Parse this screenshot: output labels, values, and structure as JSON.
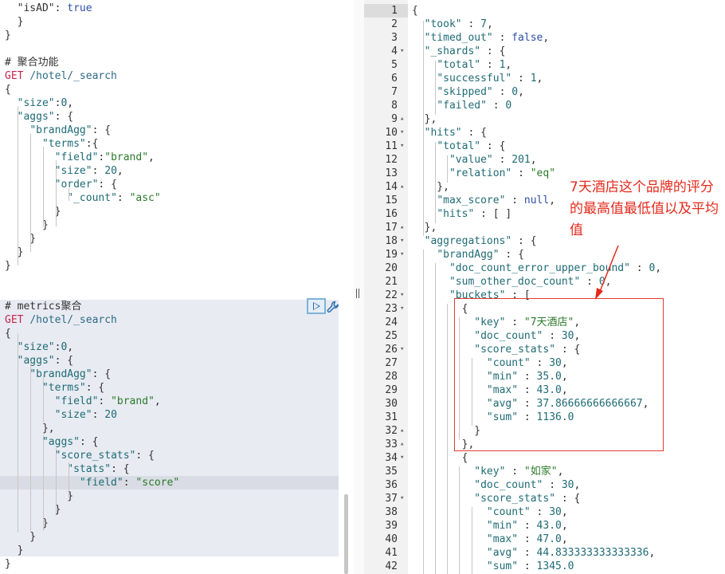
{
  "colors": {
    "accent": "#2b6cb0",
    "annotation": "#e32a1c",
    "request_bg": "#e8ebf2",
    "gutter": "#f2f2f2"
  },
  "icons": {
    "run": "play-icon",
    "settings": "wrench-icon",
    "splitter": "splitter-handle-icon"
  },
  "left_editor": {
    "lines": [
      [
        [
          "punc",
          "  \"isAD\": "
        ],
        [
          "bool",
          "true"
        ]
      ],
      [
        [
          "punc",
          "  }"
        ]
      ],
      [
        [
          "punc",
          "}"
        ]
      ],
      [],
      [
        [
          "comment",
          "# 聚合功能"
        ]
      ],
      [
        [
          "method",
          "GET"
        ],
        [
          "punc",
          " "
        ],
        [
          "url",
          "/hotel/_search"
        ]
      ],
      [
        [
          "punc",
          "{"
        ]
      ],
      [
        [
          "punc",
          "  "
        ],
        [
          "key",
          "\"size\""
        ],
        [
          "punc",
          ":"
        ],
        [
          "num",
          "0"
        ],
        [
          "punc",
          ","
        ]
      ],
      [
        [
          "punc",
          "  "
        ],
        [
          "key",
          "\"aggs\""
        ],
        [
          "punc",
          ": {"
        ]
      ],
      [
        [
          "punc",
          "    "
        ],
        [
          "key",
          "\"brandAgg\""
        ],
        [
          "punc",
          ": {"
        ]
      ],
      [
        [
          "punc",
          "      "
        ],
        [
          "key",
          "\"terms\""
        ],
        [
          "punc",
          ":{"
        ]
      ],
      [
        [
          "punc",
          "        "
        ],
        [
          "key",
          "\"field\""
        ],
        [
          "punc",
          ":"
        ],
        [
          "str",
          "\"brand\""
        ],
        [
          "punc",
          ","
        ]
      ],
      [
        [
          "punc",
          "        "
        ],
        [
          "key",
          "\"size\""
        ],
        [
          "punc",
          ": "
        ],
        [
          "num",
          "20"
        ],
        [
          "punc",
          ","
        ]
      ],
      [
        [
          "punc",
          "        "
        ],
        [
          "key",
          "\"order\""
        ],
        [
          "punc",
          ": {"
        ]
      ],
      [
        [
          "punc",
          "          "
        ],
        [
          "key",
          "\"_count\""
        ],
        [
          "punc",
          ": "
        ],
        [
          "str",
          "\"asc\""
        ]
      ],
      [
        [
          "punc",
          "        }"
        ]
      ],
      [
        [
          "punc",
          "      }"
        ]
      ],
      [
        [
          "punc",
          "    }"
        ]
      ],
      [
        [
          "punc",
          "  }"
        ]
      ],
      [
        [
          "punc",
          "}"
        ]
      ],
      [],
      [],
      [
        [
          "comment",
          "# metrics聚合"
        ]
      ],
      [
        [
          "method",
          "GET"
        ],
        [
          "punc",
          " "
        ],
        [
          "url",
          "/hotel/_search"
        ]
      ],
      [
        [
          "punc",
          "{"
        ]
      ],
      [
        [
          "punc",
          "  "
        ],
        [
          "key",
          "\"size\""
        ],
        [
          "punc",
          ":"
        ],
        [
          "num",
          "0"
        ],
        [
          "punc",
          ","
        ]
      ],
      [
        [
          "punc",
          "  "
        ],
        [
          "key",
          "\"aggs\""
        ],
        [
          "punc",
          ": {"
        ]
      ],
      [
        [
          "punc",
          "    "
        ],
        [
          "key",
          "\"brandAgg\""
        ],
        [
          "punc",
          ": {"
        ]
      ],
      [
        [
          "punc",
          "      "
        ],
        [
          "key",
          "\"terms\""
        ],
        [
          "punc",
          ": {"
        ]
      ],
      [
        [
          "punc",
          "        "
        ],
        [
          "key",
          "\"field\""
        ],
        [
          "punc",
          ": "
        ],
        [
          "str",
          "\"brand\""
        ],
        [
          "punc",
          ","
        ]
      ],
      [
        [
          "punc",
          "        "
        ],
        [
          "key",
          "\"size\""
        ],
        [
          "punc",
          ": "
        ],
        [
          "num",
          "20"
        ]
      ],
      [
        [
          "punc",
          "      },"
        ]
      ],
      [
        [
          "punc",
          "      "
        ],
        [
          "key",
          "\"aggs\""
        ],
        [
          "punc",
          ": {"
        ]
      ],
      [
        [
          "punc",
          "        "
        ],
        [
          "key",
          "\"score_stats\""
        ],
        [
          "punc",
          ": {"
        ]
      ],
      [
        [
          "punc",
          "          "
        ],
        [
          "key",
          "\"stats\""
        ],
        [
          "punc",
          ": {"
        ]
      ],
      [
        [
          "punc",
          "            "
        ],
        [
          "key",
          "\"field\""
        ],
        [
          "punc",
          ": "
        ],
        [
          "str",
          "\"score\""
        ]
      ],
      [
        [
          "punc",
          "          }"
        ]
      ],
      [
        [
          "punc",
          "        }"
        ]
      ],
      [
        [
          "punc",
          "      }"
        ]
      ],
      [
        [
          "punc",
          "    }"
        ]
      ],
      [
        [
          "punc",
          "  }"
        ]
      ],
      [
        [
          "punc",
          "}"
        ]
      ]
    ]
  },
  "right_editor": {
    "line_numbers": [
      "1",
      "2",
      "3",
      "4",
      "5",
      "6",
      "7",
      "8",
      "9",
      "10",
      "11",
      "12",
      "13",
      "14",
      "15",
      "16",
      "17",
      "18",
      "19",
      "20",
      "21",
      "22",
      "23",
      "24",
      "25",
      "26",
      "27",
      "28",
      "29",
      "30",
      "31",
      "32",
      "33",
      "34",
      "35",
      "36",
      "37",
      "38",
      "39",
      "40",
      "41",
      "42"
    ],
    "lines": [
      [
        [
          "punc",
          "{"
        ]
      ],
      [
        [
          "punc",
          "  "
        ],
        [
          "key",
          "\"took\""
        ],
        [
          "punc",
          " : "
        ],
        [
          "num",
          "7"
        ],
        [
          "punc",
          ","
        ]
      ],
      [
        [
          "punc",
          "  "
        ],
        [
          "key",
          "\"timed_out\""
        ],
        [
          "punc",
          " : "
        ],
        [
          "bool",
          "false"
        ],
        [
          "punc",
          ","
        ]
      ],
      [
        [
          "punc",
          "  "
        ],
        [
          "key",
          "\"_shards\""
        ],
        [
          "punc",
          " : {"
        ]
      ],
      [
        [
          "punc",
          "    "
        ],
        [
          "key",
          "\"total\""
        ],
        [
          "punc",
          " : "
        ],
        [
          "num",
          "1"
        ],
        [
          "punc",
          ","
        ]
      ],
      [
        [
          "punc",
          "    "
        ],
        [
          "key",
          "\"successful\""
        ],
        [
          "punc",
          " : "
        ],
        [
          "num",
          "1"
        ],
        [
          "punc",
          ","
        ]
      ],
      [
        [
          "punc",
          "    "
        ],
        [
          "key",
          "\"skipped\""
        ],
        [
          "punc",
          " : "
        ],
        [
          "num",
          "0"
        ],
        [
          "punc",
          ","
        ]
      ],
      [
        [
          "punc",
          "    "
        ],
        [
          "key",
          "\"failed\""
        ],
        [
          "punc",
          " : "
        ],
        [
          "num",
          "0"
        ]
      ],
      [
        [
          "punc",
          "  },"
        ]
      ],
      [
        [
          "punc",
          "  "
        ],
        [
          "key",
          "\"hits\""
        ],
        [
          "punc",
          " : {"
        ]
      ],
      [
        [
          "punc",
          "    "
        ],
        [
          "key",
          "\"total\""
        ],
        [
          "punc",
          " : {"
        ]
      ],
      [
        [
          "punc",
          "      "
        ],
        [
          "key",
          "\"value\""
        ],
        [
          "punc",
          " : "
        ],
        [
          "num",
          "201"
        ],
        [
          "punc",
          ","
        ]
      ],
      [
        [
          "punc",
          "      "
        ],
        [
          "key",
          "\"relation\""
        ],
        [
          "punc",
          " : "
        ],
        [
          "str",
          "\"eq\""
        ]
      ],
      [
        [
          "punc",
          "    },"
        ]
      ],
      [
        [
          "punc",
          "    "
        ],
        [
          "key",
          "\"max_score\""
        ],
        [
          "punc",
          " : "
        ],
        [
          "bool",
          "null"
        ],
        [
          "punc",
          ","
        ]
      ],
      [
        [
          "punc",
          "    "
        ],
        [
          "key",
          "\"hits\""
        ],
        [
          "punc",
          " : [ ]"
        ]
      ],
      [
        [
          "punc",
          "  },"
        ]
      ],
      [
        [
          "punc",
          "  "
        ],
        [
          "key",
          "\"aggregations\""
        ],
        [
          "punc",
          " : {"
        ]
      ],
      [
        [
          "punc",
          "    "
        ],
        [
          "key",
          "\"brandAgg\""
        ],
        [
          "punc",
          " : {"
        ]
      ],
      [
        [
          "punc",
          "      "
        ],
        [
          "key",
          "\"doc_count_error_upper_bound\""
        ],
        [
          "punc",
          " : "
        ],
        [
          "num",
          "0"
        ],
        [
          "punc",
          ","
        ]
      ],
      [
        [
          "punc",
          "      "
        ],
        [
          "key",
          "\"sum_other_doc_count\""
        ],
        [
          "punc",
          " : "
        ],
        [
          "num",
          "0"
        ],
        [
          "punc",
          ","
        ]
      ],
      [
        [
          "punc",
          "      "
        ],
        [
          "key",
          "\"buckets\""
        ],
        [
          "punc",
          " : ["
        ]
      ],
      [
        [
          "punc",
          "        {"
        ]
      ],
      [
        [
          "punc",
          "          "
        ],
        [
          "key",
          "\"key\""
        ],
        [
          "punc",
          " : "
        ],
        [
          "str",
          "\"7天酒店\""
        ],
        [
          "punc",
          ","
        ]
      ],
      [
        [
          "punc",
          "          "
        ],
        [
          "key",
          "\"doc_count\""
        ],
        [
          "punc",
          " : "
        ],
        [
          "num",
          "30"
        ],
        [
          "punc",
          ","
        ]
      ],
      [
        [
          "punc",
          "          "
        ],
        [
          "key",
          "\"score_stats\""
        ],
        [
          "punc",
          " : {"
        ]
      ],
      [
        [
          "punc",
          "            "
        ],
        [
          "key",
          "\"count\""
        ],
        [
          "punc",
          " : "
        ],
        [
          "num",
          "30"
        ],
        [
          "punc",
          ","
        ]
      ],
      [
        [
          "punc",
          "            "
        ],
        [
          "key",
          "\"min\""
        ],
        [
          "punc",
          " : "
        ],
        [
          "num",
          "35.0"
        ],
        [
          "punc",
          ","
        ]
      ],
      [
        [
          "punc",
          "            "
        ],
        [
          "key",
          "\"max\""
        ],
        [
          "punc",
          " : "
        ],
        [
          "num",
          "43.0"
        ],
        [
          "punc",
          ","
        ]
      ],
      [
        [
          "punc",
          "            "
        ],
        [
          "key",
          "\"avg\""
        ],
        [
          "punc",
          " : "
        ],
        [
          "num",
          "37.86666666666667"
        ],
        [
          "punc",
          ","
        ]
      ],
      [
        [
          "punc",
          "            "
        ],
        [
          "key",
          "\"sum\""
        ],
        [
          "punc",
          " : "
        ],
        [
          "num",
          "1136.0"
        ]
      ],
      [
        [
          "punc",
          "          }"
        ]
      ],
      [
        [
          "punc",
          "        },"
        ]
      ],
      [
        [
          "punc",
          "        {"
        ]
      ],
      [
        [
          "punc",
          "          "
        ],
        [
          "key",
          "\"key\""
        ],
        [
          "punc",
          " : "
        ],
        [
          "str",
          "\"如家\""
        ],
        [
          "punc",
          ","
        ]
      ],
      [
        [
          "punc",
          "          "
        ],
        [
          "key",
          "\"doc_count\""
        ],
        [
          "punc",
          " : "
        ],
        [
          "num",
          "30"
        ],
        [
          "punc",
          ","
        ]
      ],
      [
        [
          "punc",
          "          "
        ],
        [
          "key",
          "\"score_stats\""
        ],
        [
          "punc",
          " : {"
        ]
      ],
      [
        [
          "punc",
          "            "
        ],
        [
          "key",
          "\"count\""
        ],
        [
          "punc",
          " : "
        ],
        [
          "num",
          "30"
        ],
        [
          "punc",
          ","
        ]
      ],
      [
        [
          "punc",
          "            "
        ],
        [
          "key",
          "\"min\""
        ],
        [
          "punc",
          " : "
        ],
        [
          "num",
          "43.0"
        ],
        [
          "punc",
          ","
        ]
      ],
      [
        [
          "punc",
          "            "
        ],
        [
          "key",
          "\"max\""
        ],
        [
          "punc",
          " : "
        ],
        [
          "num",
          "47.0"
        ],
        [
          "punc",
          ","
        ]
      ],
      [
        [
          "punc",
          "            "
        ],
        [
          "key",
          "\"avg\""
        ],
        [
          "punc",
          " : "
        ],
        [
          "num",
          "44.833333333333336"
        ],
        [
          "punc",
          ","
        ]
      ],
      [
        [
          "punc",
          "            "
        ],
        [
          "key",
          "\"sum\""
        ],
        [
          "punc",
          " : "
        ],
        [
          "num",
          "1345.0"
        ]
      ]
    ]
  },
  "annotation": {
    "text": "7天酒店这个品牌的评分的最高值最低值以及平均值"
  }
}
